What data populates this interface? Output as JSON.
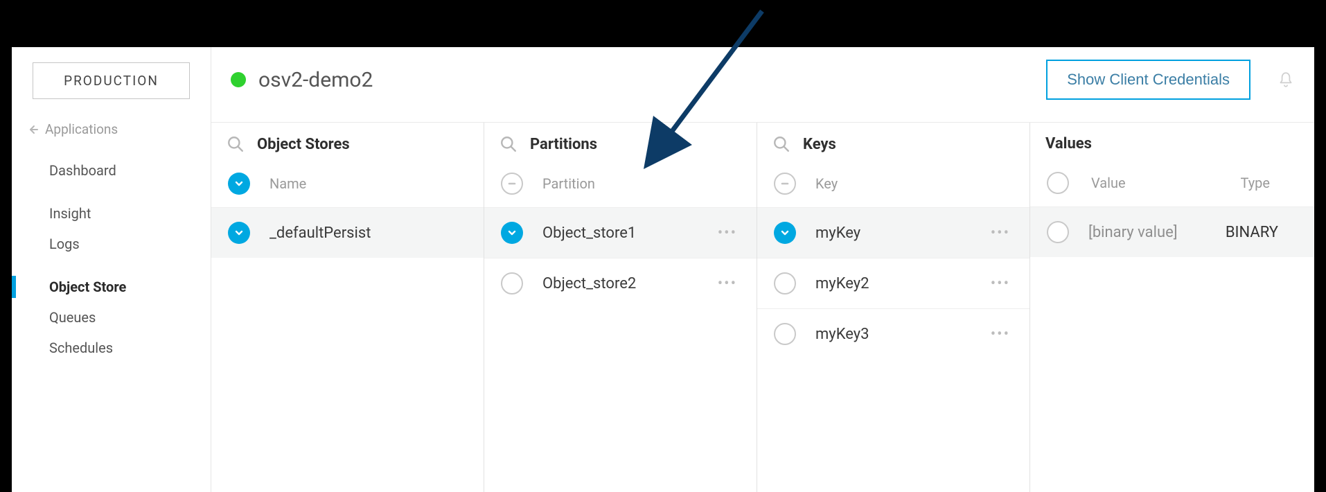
{
  "sidebar": {
    "env_label": "PRODUCTION",
    "back_label": "Applications",
    "nav": [
      {
        "label": "Dashboard",
        "active": false
      },
      {
        "label": "Insight",
        "active": false
      },
      {
        "label": "Logs",
        "active": false
      },
      {
        "label": "Object Store",
        "active": true
      },
      {
        "label": "Queues",
        "active": false
      },
      {
        "label": "Schedules",
        "active": false
      }
    ]
  },
  "header": {
    "app_name": "osv2-demo2",
    "button_label": "Show Client Credentials"
  },
  "columns": {
    "object_stores": {
      "title": "Object Stores",
      "sub_label": "Name",
      "rows": [
        {
          "label": "_defaultPersist",
          "selected": true
        }
      ]
    },
    "partitions": {
      "title": "Partitions",
      "sub_label": "Partition",
      "rows": [
        {
          "label": "Object_store1",
          "selected": true
        },
        {
          "label": "Object_store2",
          "selected": false
        }
      ]
    },
    "keys": {
      "title": "Keys",
      "sub_label": "Key",
      "rows": [
        {
          "label": "myKey",
          "selected": true
        },
        {
          "label": "myKey2",
          "selected": false
        },
        {
          "label": "myKey3",
          "selected": false
        }
      ]
    },
    "values": {
      "title": "Values",
      "sub_value_label": "Value",
      "sub_type_label": "Type",
      "rows": [
        {
          "value": "[binary value]",
          "type": "BINARY"
        }
      ]
    }
  }
}
